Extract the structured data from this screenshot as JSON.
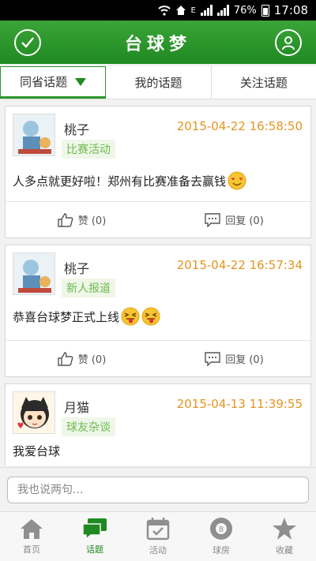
{
  "status_bar": {
    "battery": "76%",
    "time": "17:08",
    "network": "E"
  },
  "app_bar": {
    "title": "台球梦"
  },
  "tabs": [
    {
      "label": "同省话题",
      "active": true
    },
    {
      "label": "我的话题",
      "active": false
    },
    {
      "label": "关注话题",
      "active": false
    }
  ],
  "posts": [
    {
      "author": "桃子",
      "time": "2015-04-22 16:58:50",
      "tag": "比赛活动",
      "content": "人多点就更好啦！郑州有比赛准备去赢钱",
      "emojis": [
        "heart-eyes"
      ],
      "like_label": "赞 (0)",
      "reply_label": "回复 (0)"
    },
    {
      "author": "桃子",
      "time": "2015-04-22 16:57:34",
      "tag": "新人报道",
      "content": "恭喜台球梦正式上线",
      "emojis": [
        "tongue-face",
        "tongue-face"
      ],
      "like_label": "赞 (0)",
      "reply_label": "回复 (0)"
    },
    {
      "author": "月猫",
      "time": "2015-04-13 11:39:55",
      "tag": "球友杂谈",
      "content": "我爱台球",
      "emojis": []
    }
  ],
  "comment_input": {
    "placeholder": "我也说两句..."
  },
  "bottom_nav": [
    {
      "label": "首页",
      "icon": "home-icon",
      "active": false
    },
    {
      "label": "话题",
      "icon": "chat-icon",
      "active": true
    },
    {
      "label": "活动",
      "icon": "calendar-icon",
      "active": false
    },
    {
      "label": "球房",
      "icon": "billiard-ball-icon",
      "active": false
    },
    {
      "label": "收藏",
      "icon": "star-icon",
      "active": false
    }
  ],
  "colors": {
    "primary_green": "#1f8a22",
    "time_orange": "#e49422",
    "tag_green": "#6dba4f"
  }
}
